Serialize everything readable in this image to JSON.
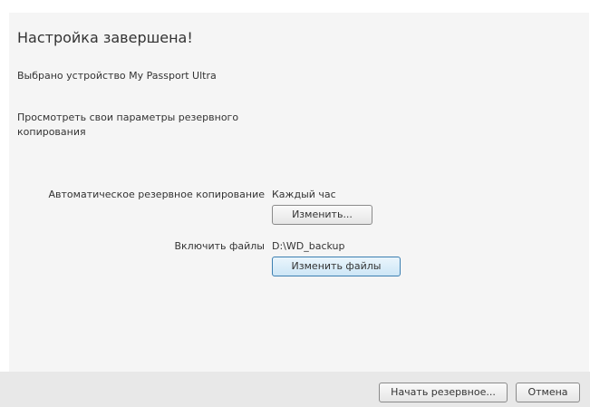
{
  "dialog": {
    "title": "Настройка завершена!",
    "selected_device": "Выбрано устройство My Passport Ultra",
    "review_text": "Просмотреть свои параметры резервного копирования"
  },
  "settings": {
    "auto_backup_label": "Автоматическое резервное копирование",
    "auto_backup_value": "Каждый час",
    "auto_backup_change_button": "Изменить...",
    "include_files_label": "Включить файлы",
    "include_files_value": "D:\\WD_backup",
    "include_files_change_button": "Изменить файлы"
  },
  "footer": {
    "start_backup_button": "Начать резервное...",
    "cancel_button": "Отмена"
  },
  "colors": {
    "panel_background": "#f5f5f5",
    "footer_background": "#e8e8e8",
    "focused_button_accent": "#3c7fb1"
  }
}
